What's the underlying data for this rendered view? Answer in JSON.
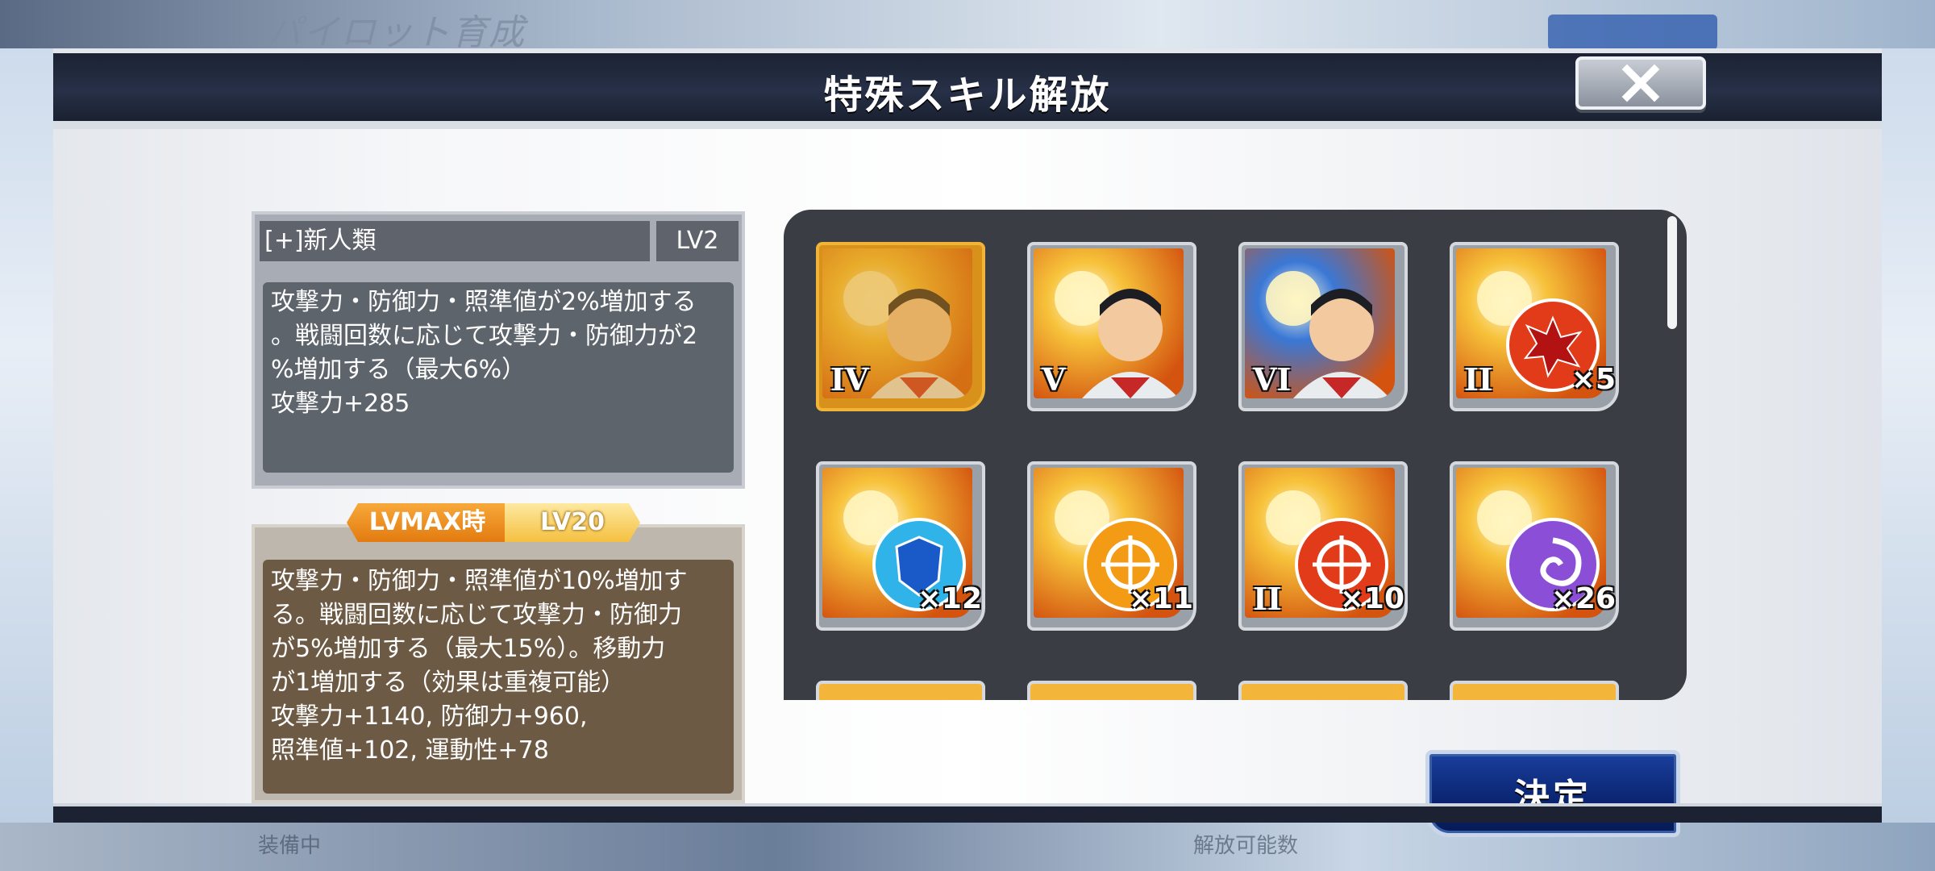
{
  "background": {
    "top_title": "パイロット育成",
    "bottom_texts": [
      "装備中",
      "解放可能数"
    ]
  },
  "dialog": {
    "title": "特殊スキル解放",
    "close_label": "✕"
  },
  "current_skill": {
    "name": "[+]新人類",
    "level": "LV2",
    "description_lines": [
      "攻撃力・防御力・照準値が2%増加する",
      "。戦闘回数に応じて攻撃力・防御力が2",
      "%増加する（最大6%）",
      "攻撃力+285"
    ]
  },
  "max_skill": {
    "badge_label": "LVMAX時",
    "badge_level": "LV20",
    "description_lines": [
      "攻撃力・防御力・照準値が10%増加す",
      "る。戦闘回数に応じて攻撃力・防御力",
      "が5%増加する（最大15%）。移動力",
      "が1増加する（効果は重複可能）",
      "攻撃力+1140, 防御力+960,",
      "照準値+102, 運動性+78"
    ]
  },
  "items": [
    {
      "tier": "IV",
      "count": "",
      "type": "pilot",
      "selected": true
    },
    {
      "tier": "V",
      "count": "",
      "type": "pilot",
      "selected": false
    },
    {
      "tier": "VI",
      "count": "",
      "type": "pilot-blue",
      "selected": false
    },
    {
      "tier": "II",
      "count": "×5",
      "type": "attack",
      "selected": false
    },
    {
      "tier": "",
      "count": "×12",
      "type": "defense",
      "selected": false
    },
    {
      "tier": "",
      "count": "×11",
      "type": "aim",
      "selected": false
    },
    {
      "tier": "II",
      "count": "×10",
      "type": "aim-red",
      "selected": false
    },
    {
      "tier": "",
      "count": "×26",
      "type": "mobility",
      "selected": false
    }
  ],
  "confirm_label": "決定",
  "colors": {
    "header": "#1b2233",
    "confirm": "#0a2470",
    "selected_frame": "#d8921c",
    "max_panel": "#6d5a44"
  }
}
